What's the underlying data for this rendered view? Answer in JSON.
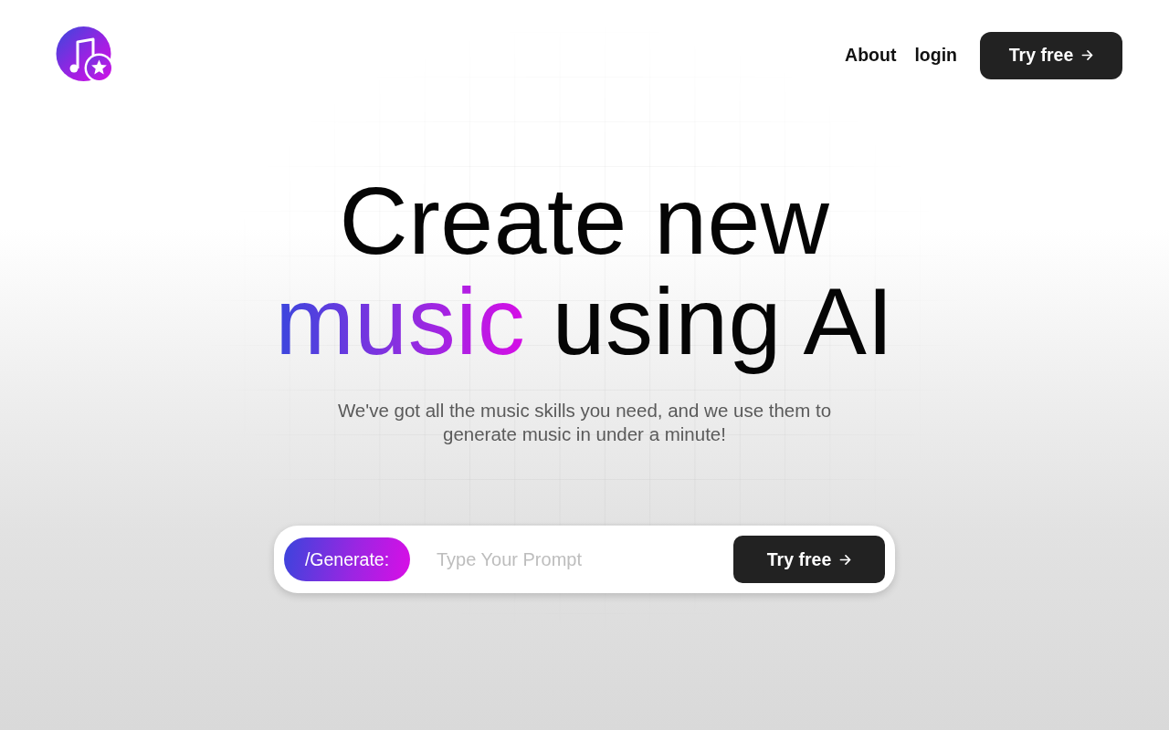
{
  "header": {
    "nav_links": [
      "About",
      "login"
    ],
    "cta": {
      "label": "Try free"
    }
  },
  "hero": {
    "headline": {
      "line_1": "Create new",
      "highlight": "music",
      "line_2_rest": "using AI"
    },
    "subtitle": "We've got all the music skills you need, and we use them to generate music in under a minute!",
    "prompt_bar": {
      "command": "/Generate:",
      "placeholder": "Type Your Prompt",
      "button": "Try free"
    }
  }
}
